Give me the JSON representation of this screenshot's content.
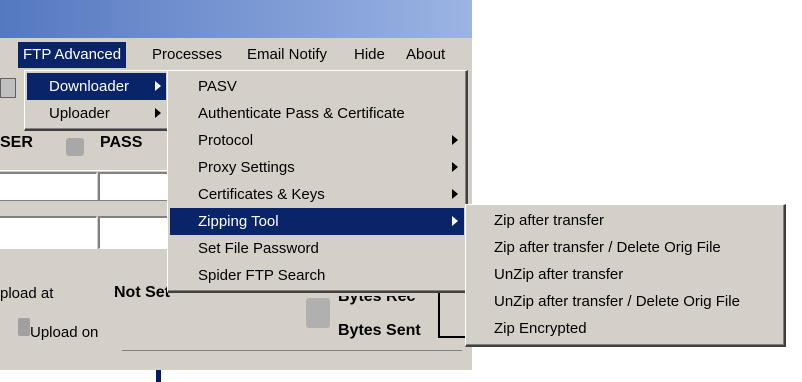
{
  "menubar": {
    "items": [
      {
        "label": "FTP Advanced"
      },
      {
        "label": "Processes"
      },
      {
        "label": "Email Notify"
      },
      {
        "label": "Hide"
      },
      {
        "label": "About"
      }
    ]
  },
  "form": {
    "user_label": "SER",
    "pass_label": "PASS",
    "upload_at_label": "pload at",
    "upload_at_value": "Not Set",
    "upload_on_label": "Upload on",
    "bytes_rec_label": "Bytes Rec",
    "bytes_sent_label": "Bytes Sent"
  },
  "menu_ftp_advanced": {
    "items": [
      {
        "label": "Downloader",
        "submenu": true
      },
      {
        "label": "Uploader",
        "submenu": true
      }
    ]
  },
  "menu_downloader": {
    "items": [
      {
        "label": "PASV",
        "submenu": false
      },
      {
        "label": "Authenticate Pass & Certificate",
        "submenu": false
      },
      {
        "label": "Protocol",
        "submenu": true
      },
      {
        "label": "Proxy Settings",
        "submenu": true
      },
      {
        "label": "Certificates & Keys",
        "submenu": true
      },
      {
        "label": "Zipping Tool",
        "submenu": true
      },
      {
        "label": "Set File Password",
        "submenu": false
      },
      {
        "label": "Spider FTP Search",
        "submenu": false
      }
    ]
  },
  "menu_zipping": {
    "items": [
      {
        "label": "Zip after transfer"
      },
      {
        "label": "Zip after transfer / Delete Orig File"
      },
      {
        "label": "UnZip after transfer"
      },
      {
        "label": "UnZip after transfer / Delete Orig File"
      },
      {
        "label": "Zip Encrypted"
      }
    ]
  },
  "colors": {
    "menu_bg": "#d4d0c8",
    "highlight": "#0a246a",
    "title_left": "#5478c0",
    "title_right": "#9cb4e4"
  },
  "icons": [
    "submenu-arrow-icon",
    "toolbar-icon"
  ]
}
